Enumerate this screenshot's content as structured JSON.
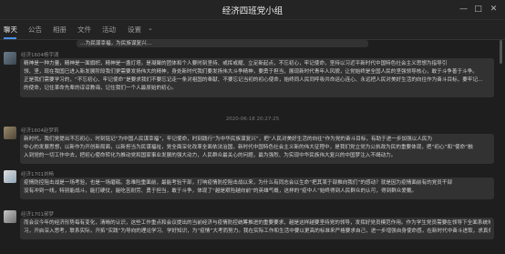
{
  "window": {
    "title": "经济四班党小组",
    "close_icon": "close-icon"
  },
  "tabs": {
    "items": [
      {
        "label": "聊天"
      },
      {
        "label": "公告"
      },
      {
        "label": "相册"
      },
      {
        "label": "文件"
      },
      {
        "label": "活动"
      },
      {
        "label": "设置"
      }
    ],
    "active": "聊天"
  },
  "chat": {
    "top_bubble_line": "…为民谋幸福，为民族谋复兴…",
    "timestamp": "2020-06-18 20:27:25",
    "messages": [
      {
        "sender": "经济1604杨宇潇",
        "lines": [
          "精神是一种力量，精神是一面旗帜，精神是一盏灯塔。是凝聚的团体和个人要时刻坚持、或挥或耀、立足新起点，不忘初心，牢记使命，坚持以习近平新时代中国特色社会主义思想为指导引",
          "领、坚，现在我国已进入新发展阶段我们更需要发扬伟大的精神，身处新时代我们要发扬伟大斗争精神，要勇于担当，展现新时代青年人风貌，让党始终是全国人民的坚强领导核心，敢于斗争善于斗争。",
          "正是我们需要学习的，“不忘初心、牢记使命”是要求我们不要忘记走一条对祖国的奉献、不要忘记当初的初心使命，始终同人民同呼吸共命运心连心、永远把人民对美好生活的向往作为奋斗目标，要牢记…",
          "的使命，记住革命先辈的谆谆教诲，记住我们一个人最原始的初心。"
        ]
      },
      {
        "sender": "经济1604赵梦莉",
        "lines": [
          "新时代，我们党提出不忘初心，时刻铭记“为中国人民谋幸福”，牢记使命，时刻践行“为中华民族谋复兴”，把“人民对美好生活的向往”作为党的奋斗目标，有助于进一步加强以人民为",
          "中心的发展思想，以新作为开创新局面，以新担当为民谋福祉，党全面深化改革全面依法治国，新时代中国特色社会主义新的伟大征程中，是我们党立党为公执政为民的重要体现，把“初心”和“使命”融",
          "入到党的一切工作中去，把初心使命转化为推动党和国家事业发展的强大动力，人民群众最关心的问题，最为强烈、为实现中华民族伟大复兴的中国梦注入不竭动力。"
        ]
      },
      {
        "sender": "经济1701刘畅",
        "lines": [
          "疫情防控阻击战是一场考验，也是一场磨砺。急难险重面前，最能考验干部，打响疫情防控阻击战以来，为什么有同志会以生命“把其某于部推向我们”的感动？就是因为疫情面前有的党员干部",
          "没有冲到一线，特别能战斗，能打硬仗，能吃苦耐劳、勇于担当，敢于斗争，体现了“越是艰险越向前”的英雄气概，这样的“疫中人”始终得到人民群众的认可，得到群众爱戴。"
        ]
      },
      {
        "sender": "经济1701郝梦",
        "lines": [
          "而会议今年的经济形势每有变化，清晰的认识，这些工作重点和会议提出的当前经济与疫情防控统筹推进的重要要求，越是这样越要坚持党的领导，发挥好党员模范作用。作为学生党员需要在领导下全面系统地学",
          "习，开启深入思考，联系实际，开拓“实践”为导向的理论学习、学好知识，为“疫情”大考而努力。我在实际工作和生活中要以更高的标准来严格要求自己，进一步增强自身使命感，在新时代中奋斗进取，求真务实，有所作为。"
        ]
      }
    ]
  },
  "colors": {
    "background": "#1e1e1e",
    "bubble": "#323232",
    "accent": "#4a8fe6"
  }
}
